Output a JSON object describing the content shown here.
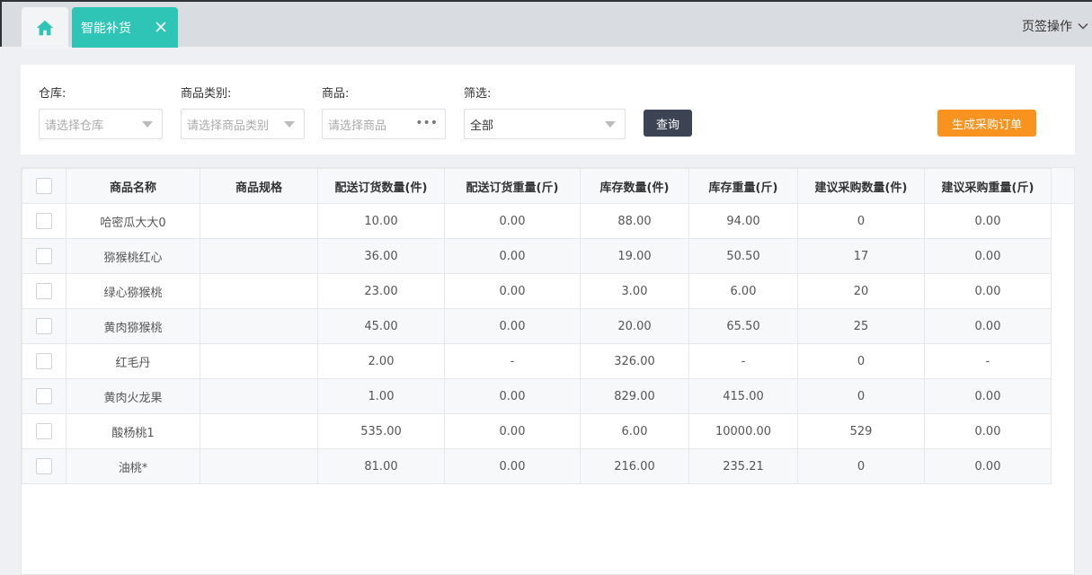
{
  "tabs": {
    "home_icon": "home-icon",
    "active_label": "智能补货",
    "operations_label": "页签操作"
  },
  "colors": {
    "accent": "#2ec5b6",
    "query_button": "#3c4353",
    "generate_button": "#f7931e"
  },
  "filters": {
    "warehouse": {
      "label": "仓库:",
      "placeholder": "请选择仓库"
    },
    "category": {
      "label": "商品类别:",
      "placeholder": "请选择商品类别"
    },
    "product": {
      "label": "商品:",
      "placeholder": "请选择商品"
    },
    "screen": {
      "label": "筛选:",
      "value": "全部"
    },
    "query_button": "查询",
    "generate_button": "生成采购订单"
  },
  "table": {
    "headers": [
      "商品名称",
      "商品规格",
      "配送订货数量(件)",
      "配送订货重量(斤)",
      "库存数量(件)",
      "库存重量(斤)",
      "建议采购数量(件)",
      "建议采购重量(斤)"
    ],
    "rows": [
      [
        "哈密瓜大大0",
        "",
        "10.00",
        "0.00",
        "88.00",
        "94.00",
        "0",
        "0.00"
      ],
      [
        "猕猴桃红心",
        "",
        "36.00",
        "0.00",
        "19.00",
        "50.50",
        "17",
        "0.00"
      ],
      [
        "绿心猕猴桃",
        "",
        "23.00",
        "0.00",
        "3.00",
        "6.00",
        "20",
        "0.00"
      ],
      [
        "黄肉猕猴桃",
        "",
        "45.00",
        "0.00",
        "20.00",
        "65.50",
        "25",
        "0.00"
      ],
      [
        "红毛丹",
        "",
        "2.00",
        "-",
        "326.00",
        "-",
        "0",
        "-"
      ],
      [
        "黄肉火龙果",
        "",
        "1.00",
        "0.00",
        "829.00",
        "415.00",
        "0",
        "0.00"
      ],
      [
        "酸杨桃1",
        "",
        "535.00",
        "0.00",
        "6.00",
        "10000.00",
        "529",
        "0.00"
      ],
      [
        "油桃*",
        "",
        "81.00",
        "0.00",
        "216.00",
        "235.21",
        "0",
        "0.00"
      ]
    ]
  }
}
